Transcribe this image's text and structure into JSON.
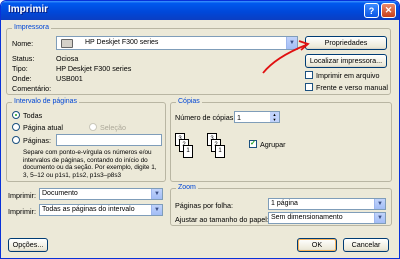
{
  "window": {
    "title": "Imprimir",
    "help_label": "?",
    "close_label": "✕"
  },
  "printer": {
    "group_label": "Impressora",
    "name_label": "Nome:",
    "name_value": "HP Deskjet F300 series",
    "status_label": "Status:",
    "status_value": "Ociosa",
    "type_label": "Tipo:",
    "type_value": "HP Deskjet F300 series",
    "where_label": "Onde:",
    "where_value": "USB001",
    "comment_label": "Comentário:",
    "comment_value": "",
    "properties_button": "Propriedades",
    "find_printer_button": "Localizar impressora...",
    "print_to_file_label": "Imprimir em arquivo",
    "duplex_label": "Frente e verso manual"
  },
  "page_range": {
    "group_label": "Intervalo de páginas",
    "all_label": "Todas",
    "current_label": "Página atual",
    "selection_label": "Seleção",
    "pages_label": "Páginas:",
    "pages_value": "",
    "help_text": "Separe com ponto-e-vírgula os números e/ou intervalos de páginas, contando do início do documento ou da seção. Por exemplo, digite 1, 3, 5–12 ou p1s1, p1s2, p1s3–p8s3"
  },
  "copies": {
    "group_label": "Cópias",
    "count_label": "Número de cópias:",
    "count_value": "1",
    "collate_label": "Agrupar",
    "collate_checked": true
  },
  "print_what": {
    "label": "Imprimir:",
    "value": "Documento"
  },
  "print_pages": {
    "label": "Imprimir:",
    "value": "Todas as páginas do intervalo"
  },
  "zoom": {
    "group_label": "Zoom",
    "pages_per_sheet_label": "Páginas por folha:",
    "pages_per_sheet_value": "1 página",
    "scale_label": "Ajustar ao tamanho do papel:",
    "scale_value": "Sem dimensionamento"
  },
  "footer": {
    "options_button": "Opções...",
    "ok_button": "OK",
    "cancel_button": "Cancelar"
  },
  "colors": {
    "title_bar": "#0058ee",
    "dialog_bg": "#ece9d8",
    "group_label": "#0046d5",
    "annotation_arrow": "#e01010"
  }
}
